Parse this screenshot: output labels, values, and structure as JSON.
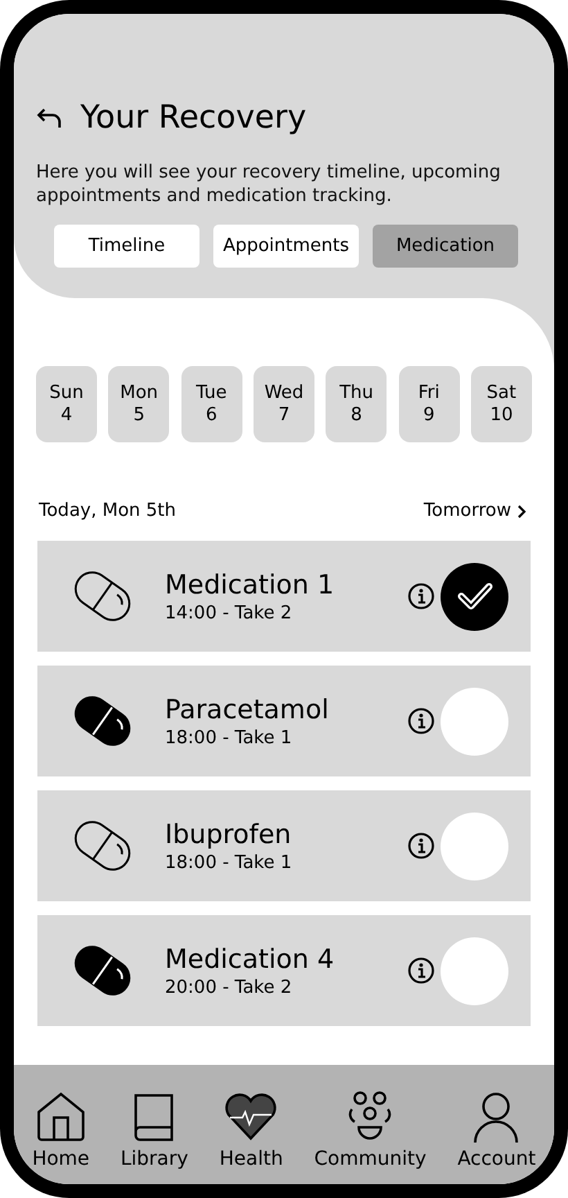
{
  "header": {
    "title": "Your Recovery",
    "description": "Here you will see your recovery timeline, upcoming appointments and medication tracking."
  },
  "tabs": [
    {
      "label": "Timeline",
      "selected": false
    },
    {
      "label": "Appointments",
      "selected": false
    },
    {
      "label": "Medication",
      "selected": true
    }
  ],
  "days": [
    {
      "weekday": "Sun",
      "date": "4"
    },
    {
      "weekday": "Mon",
      "date": "5"
    },
    {
      "weekday": "Tue",
      "date": "6"
    },
    {
      "weekday": "Wed",
      "date": "7"
    },
    {
      "weekday": "Thu",
      "date": "8"
    },
    {
      "weekday": "Fri",
      "date": "9"
    },
    {
      "weekday": "Sat",
      "date": "10"
    }
  ],
  "day_nav": {
    "current": "Today, Mon 5th",
    "next": "Tomorrow"
  },
  "medications": [
    {
      "name": "Medication 1",
      "schedule": "14:00 - Take 2",
      "icon_filled": false,
      "checked": true
    },
    {
      "name": "Paracetamol",
      "schedule": "18:00 - Take 1",
      "icon_filled": true,
      "checked": false
    },
    {
      "name": "Ibuprofen",
      "schedule": "18:00 - Take 1",
      "icon_filled": false,
      "checked": false
    },
    {
      "name": "Medication 4",
      "schedule": "20:00 - Take 2",
      "icon_filled": true,
      "checked": false
    }
  ],
  "bottom_nav": [
    {
      "label": "Home",
      "kind": "home",
      "selected": false
    },
    {
      "label": "Library",
      "kind": "book",
      "selected": false
    },
    {
      "label": "Health",
      "kind": "heart",
      "selected": true
    },
    {
      "label": "Community",
      "kind": "people",
      "selected": false
    },
    {
      "label": "Account",
      "kind": "person",
      "selected": false
    }
  ]
}
